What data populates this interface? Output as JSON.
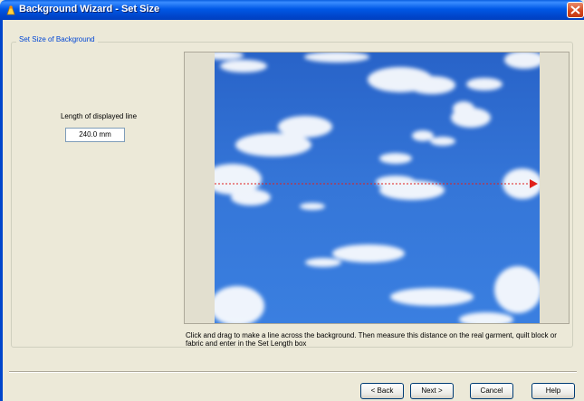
{
  "window": {
    "title": "Background Wizard - Set Size"
  },
  "group": {
    "legend": "Set Size of Background"
  },
  "length": {
    "label": "Length of displayed line",
    "value": "240.0 mm"
  },
  "instructions": "Click and drag to make a line across the background. Then measure this distance on the real garment, quilt block or fabric and enter in the Set Length box",
  "buttons": {
    "back": "< Back",
    "next": "Next >",
    "cancel": "Cancel",
    "help": "Help"
  },
  "colors": {
    "sky": "#2f6fd0",
    "measure_line": "#e0211c",
    "accent": "#0046d5"
  },
  "icons": {
    "app": "wizard-app-icon",
    "close": "close-icon",
    "arrow": "line-arrowhead-icon"
  }
}
